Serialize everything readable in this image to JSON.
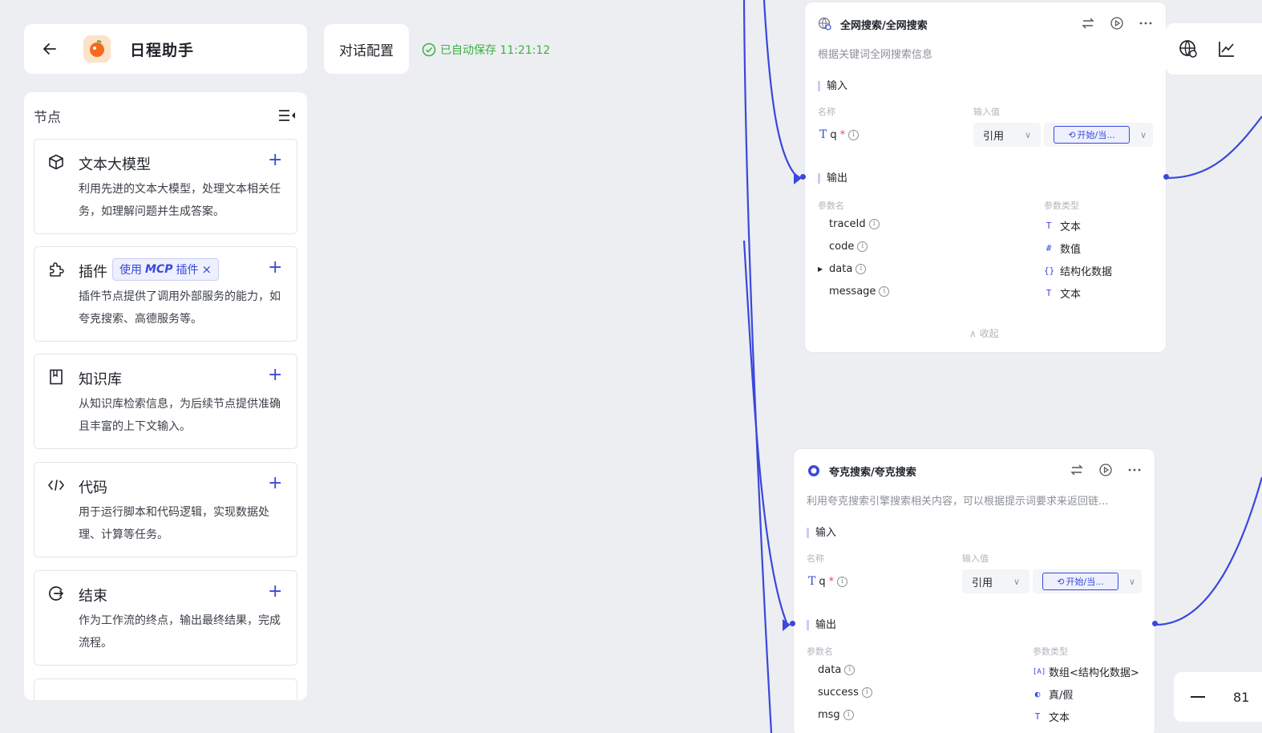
{
  "header": {
    "app_title": "日程助手",
    "config_label": "对话配置",
    "save_status": "已自动保存 11:21:12"
  },
  "panel": {
    "title": "节点",
    "nodes": [
      {
        "name": "文本大模型",
        "desc": "利用先进的文本大模型，处理文本相关任务，如理解问题并生成答案。",
        "icon": "cube-icon"
      },
      {
        "name": "插件",
        "desc": "插件节点提供了调用外部服务的能力，如夸克搜索、高德服务等。",
        "icon": "puzzle-icon",
        "tag_prefix": "使用",
        "tag_strong": "MCP",
        "tag_suffix": "插件"
      },
      {
        "name": "知识库",
        "desc": "从知识库检索信息，为后续节点提供准确且丰富的上下文输入。",
        "icon": "book-icon"
      },
      {
        "name": "代码",
        "desc": "用于运行脚本和代码逻辑，实现数据处理、计算等任务。",
        "icon": "code-icon"
      },
      {
        "name": "结束",
        "desc": "作为工作流的终点，输出最终结果，完成流程。",
        "icon": "end-icon"
      }
    ]
  },
  "wf1": {
    "title": "全网搜索/全网搜索",
    "desc": "根据关键词全网搜索信息",
    "input_label": "输入",
    "name_col": "名称",
    "value_col": "输入值",
    "param": "q",
    "ref_label": "引用",
    "ref_value": "开始/当...",
    "output_label": "输出",
    "out_name_col": "参数名",
    "out_type_col": "参数类型",
    "outputs": [
      {
        "name": "traceId",
        "type": "文本",
        "ic": "T"
      },
      {
        "name": "code",
        "type": "数值",
        "ic": "#"
      },
      {
        "name": "data",
        "type": "结构化数据",
        "ic": "{}"
      },
      {
        "name": "message",
        "type": "文本",
        "ic": "T"
      }
    ],
    "collapse": "收起"
  },
  "wf2": {
    "title": "夸克搜索/夸克搜索",
    "desc": "利用夸克搜索引擎搜索相关内容，可以根据提示词要求来返回链...",
    "input_label": "输入",
    "name_col": "名称",
    "value_col": "输入值",
    "param": "q",
    "ref_label": "引用",
    "ref_value": "开始/当...",
    "output_label": "输出",
    "out_name_col": "参数名",
    "out_type_col": "参数类型",
    "outputs": [
      {
        "name": "data",
        "type": "数组<结构化数据>",
        "ic": "[A]"
      },
      {
        "name": "success",
        "type": "真/假",
        "ic": "◐"
      },
      {
        "name": "msg",
        "type": "文本",
        "ic": "T"
      }
    ]
  },
  "zoom": {
    "value": "81"
  },
  "colors": {
    "accent": "#3a48dc",
    "success": "#3cb043",
    "canvas": "#eceef1"
  }
}
